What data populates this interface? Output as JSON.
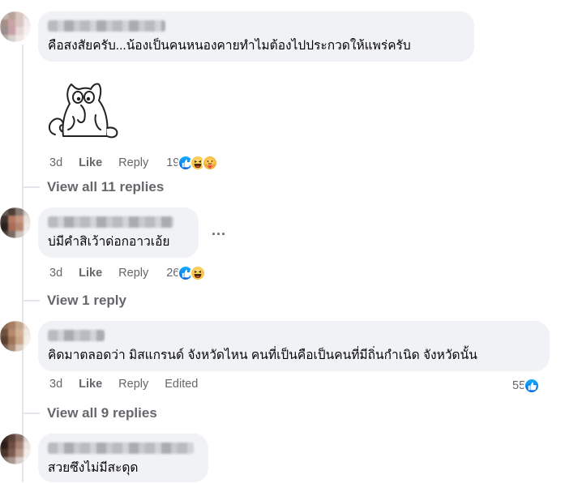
{
  "comments": [
    {
      "text": "คือสงสัยครับ...น้องเป็นคนหนองคายทำไมต้องไปประกวดให้แพร่ครับ",
      "time": "3d",
      "like": "Like",
      "reply": "Reply",
      "reaction_count": "19",
      "reactions": [
        "like-icon",
        "haha-icon",
        "care-icon"
      ],
      "view_replies": "View all 11 replies",
      "has_sticker": true
    },
    {
      "text": "บ่มีคำสิเว้าด่อกอาวเอ้ย",
      "time": "3d",
      "like": "Like",
      "reply": "Reply",
      "reaction_count": "26",
      "reactions": [
        "like-icon",
        "haha-icon"
      ],
      "view_replies": "View 1 reply",
      "more": "..."
    },
    {
      "text": "คิดมาตลอดว่า มิสแกรนด์ จังหวัดไหน คนที่เป็นคือเป็นคนที่มีถิ่นกำเนิด จังหวัดนั้น",
      "time": "3d",
      "like": "Like",
      "reply": "Reply",
      "edited": "Edited",
      "reaction_count": "55",
      "reactions": [
        "like-icon"
      ],
      "view_replies": "View all 9 replies"
    },
    {
      "text": "สวยซึงไม่มีสะดุด"
    }
  ],
  "colors": {
    "bubble": "#f0f2f5",
    "muted": "#65676b",
    "like_blue": "#1877f2"
  }
}
